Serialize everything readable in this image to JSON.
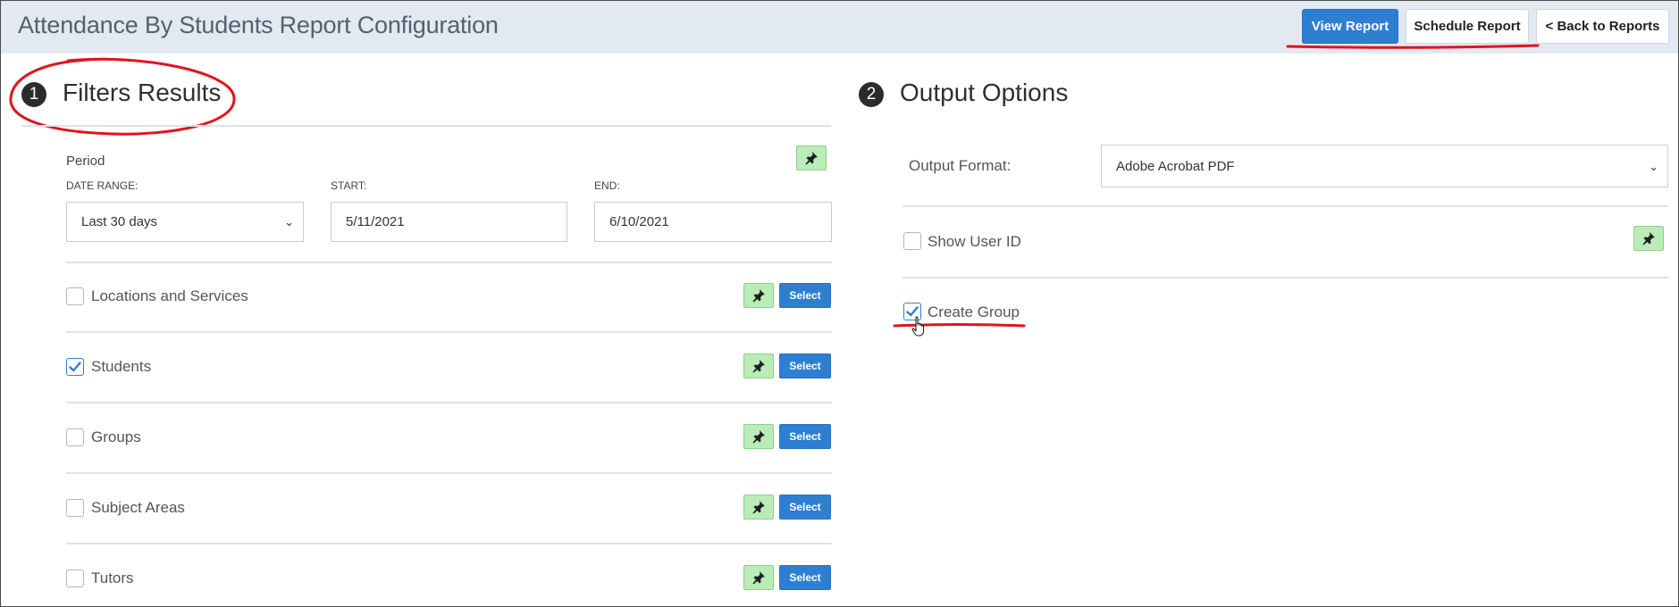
{
  "header": {
    "title": "Attendance By Students Report Configuration",
    "view_report": "View Report",
    "schedule_report": "Schedule Report",
    "back_to_reports": "< Back to Reports"
  },
  "filters": {
    "number": "1",
    "title": "Filters Results",
    "period": {
      "label": "Period",
      "date_range_label": "DATE RANGE:",
      "date_range_value": "Last 30 days",
      "start_label": "START:",
      "start_value": "5/11/2021",
      "end_label": "END:",
      "end_value": "6/10/2021"
    },
    "select_label": "Select",
    "items": [
      {
        "label": "Locations and Services",
        "checked": false
      },
      {
        "label": "Students",
        "checked": true
      },
      {
        "label": "Groups",
        "checked": false
      },
      {
        "label": "Subject Areas",
        "checked": false
      },
      {
        "label": "Tutors",
        "checked": false
      }
    ]
  },
  "output": {
    "number": "2",
    "title": "Output Options",
    "format_label": "Output Format:",
    "format_value": "Adobe Acrobat PDF",
    "show_user_id": {
      "label": "Show User ID",
      "checked": false
    },
    "create_group": {
      "label": "Create Group",
      "checked": true
    }
  },
  "colors": {
    "accent": "#2e7fd2",
    "pin_bg": "#b9ecb6",
    "header_bg": "#e3e9f1",
    "annotation": "#e0141e"
  }
}
